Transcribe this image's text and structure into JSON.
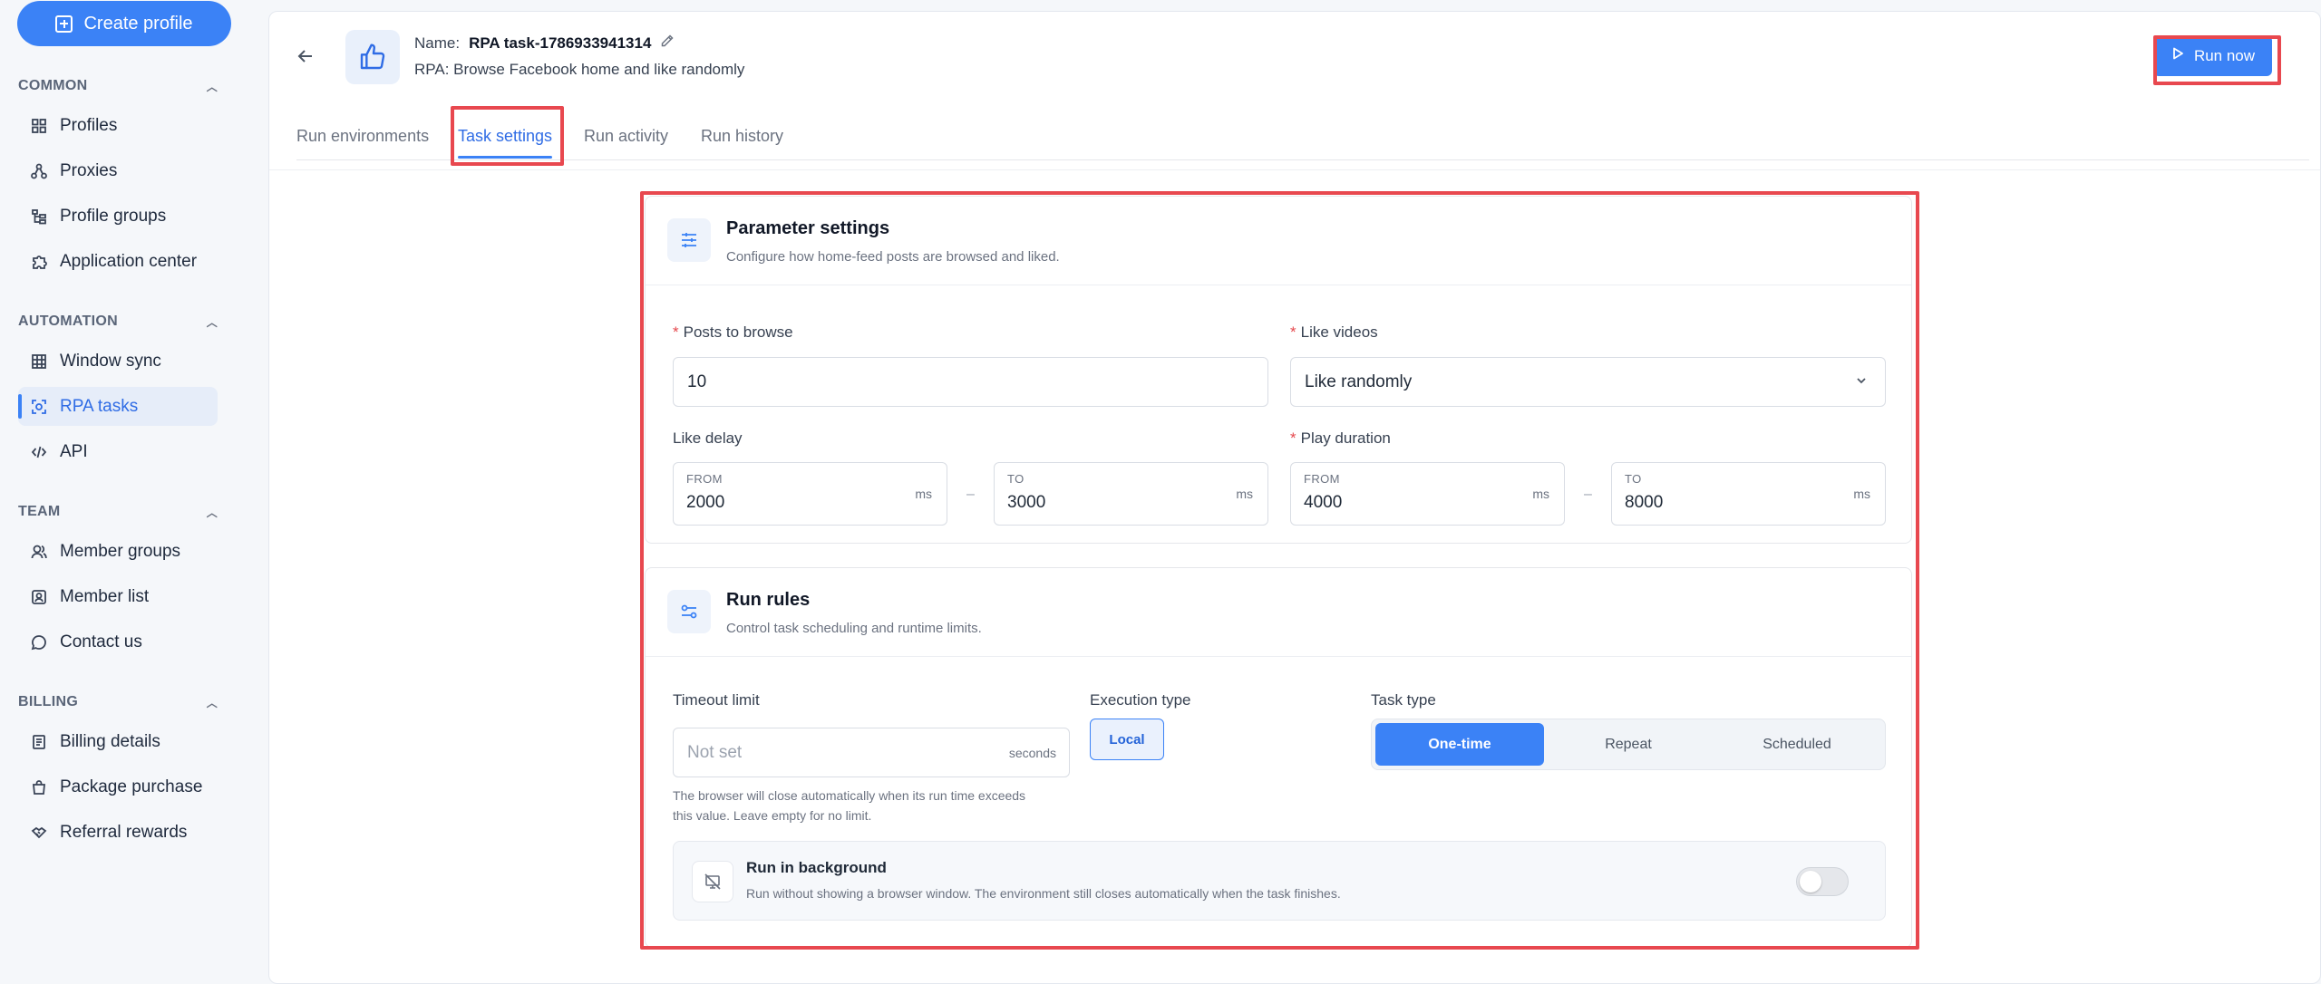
{
  "sidebar": {
    "create_label": "Create profile",
    "sections": [
      {
        "title": "COMMON",
        "items": [
          "Profiles",
          "Proxies",
          "Profile groups",
          "Application center"
        ]
      },
      {
        "title": "AUTOMATION",
        "items": [
          "Window sync",
          "RPA tasks",
          "API"
        ]
      },
      {
        "title": "TEAM",
        "items": [
          "Member groups",
          "Member list",
          "Contact us"
        ]
      },
      {
        "title": "BILLING",
        "items": [
          "Billing details",
          "Package purchase",
          "Referral rewards"
        ]
      }
    ],
    "active_item": "RPA tasks"
  },
  "header": {
    "name_label": "Name:",
    "name_value": "RPA task-1786933941314",
    "rpa_label": "RPA:",
    "rpa_value": "Browse Facebook home and like randomly",
    "run_now": "Run now"
  },
  "tabs": [
    "Run environments",
    "Task settings",
    "Run activity",
    "Run history"
  ],
  "active_tab": "Task settings",
  "params": {
    "title": "Parameter settings",
    "subtitle": "Configure how home-feed posts are browsed and liked.",
    "posts_label": "Posts to browse",
    "posts_value": "10",
    "like_videos_label": "Like videos",
    "like_videos_value": "Like randomly",
    "like_delay_label": "Like delay",
    "like_delay_from": "2000",
    "like_delay_to": "3000",
    "play_duration_label": "Play duration",
    "play_from": "4000",
    "play_to": "8000",
    "from_caption": "FROM",
    "to_caption": "TO",
    "unit_ms": "ms",
    "dash": "–"
  },
  "rules": {
    "title": "Run rules",
    "subtitle": "Control task scheduling and runtime limits.",
    "timeout_label": "Timeout limit",
    "timeout_placeholder": "Not set",
    "timeout_unit": "seconds",
    "timeout_help_1": "The browser will close automatically when its run time exceeds",
    "timeout_help_2": "this value. Leave empty for no limit.",
    "exec_label": "Execution type",
    "exec_value": "Local",
    "task_type_label": "Task type",
    "task_types": [
      "One-time",
      "Repeat",
      "Scheduled"
    ],
    "active_task_type": "One-time",
    "bg_title": "Run in background",
    "bg_desc": "Run without showing a browser window. The environment still closes automatically when the task finishes.",
    "bg_enabled": false
  },
  "colors": {
    "accent": "#3b82f6",
    "highlight": "#e8484f",
    "required": "#e5484d"
  }
}
